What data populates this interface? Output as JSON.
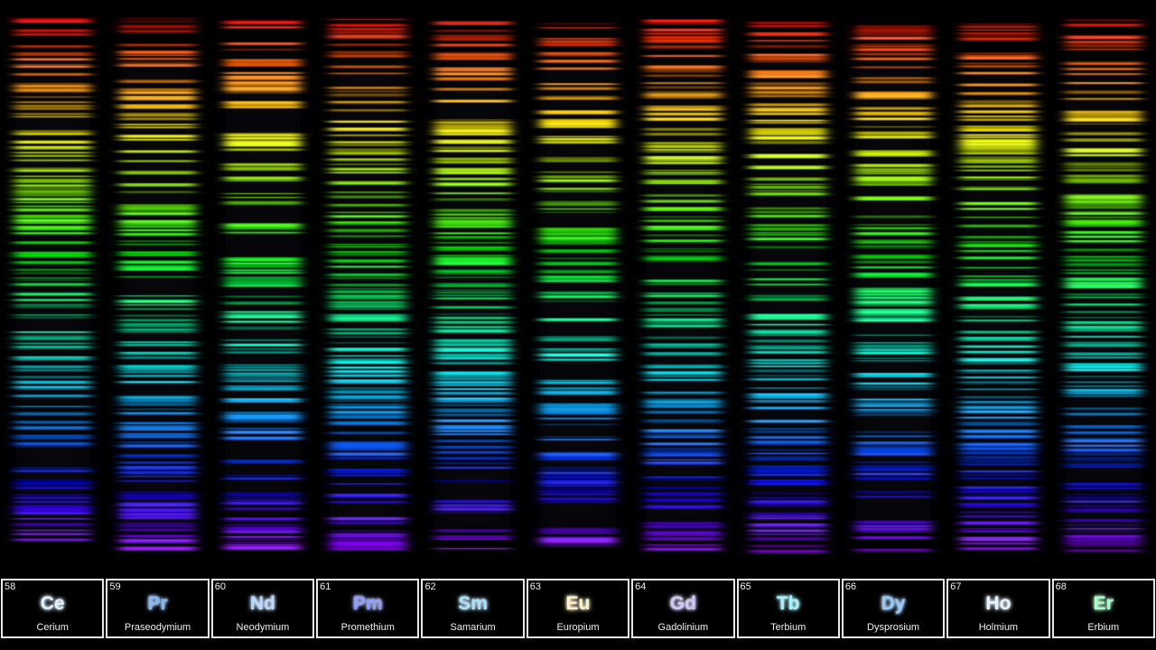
{
  "elements": [
    {
      "number": "58",
      "symbol": "Ce",
      "name": "Cerium",
      "color": "#d8f0ff"
    },
    {
      "number": "59",
      "symbol": "Pr",
      "name": "Praseodymium",
      "color": "#7fb6ff"
    },
    {
      "number": "60",
      "symbol": "Nd",
      "name": "Neodymium",
      "color": "#b9d8ff"
    },
    {
      "number": "61",
      "symbol": "Pm",
      "name": "Promethium",
      "color": "#8f9cff"
    },
    {
      "number": "62",
      "symbol": "Sm",
      "name": "Samarium",
      "color": "#a6e0ff"
    },
    {
      "number": "63",
      "symbol": "Eu",
      "name": "Europium",
      "color": "#fff2c8"
    },
    {
      "number": "64",
      "symbol": "Gd",
      "name": "Gadolinium",
      "color": "#cfc6ff"
    },
    {
      "number": "65",
      "symbol": "Tb",
      "name": "Terbium",
      "color": "#9ff2ff"
    },
    {
      "number": "66",
      "symbol": "Dy",
      "name": "Dysprosium",
      "color": "#8ec8ff"
    },
    {
      "number": "67",
      "symbol": "Ho",
      "name": "Holmium",
      "color": "#e6f4ff"
    },
    {
      "number": "68",
      "symbol": "Er",
      "name": "Erbium",
      "color": "#a9ffc8"
    }
  ]
}
